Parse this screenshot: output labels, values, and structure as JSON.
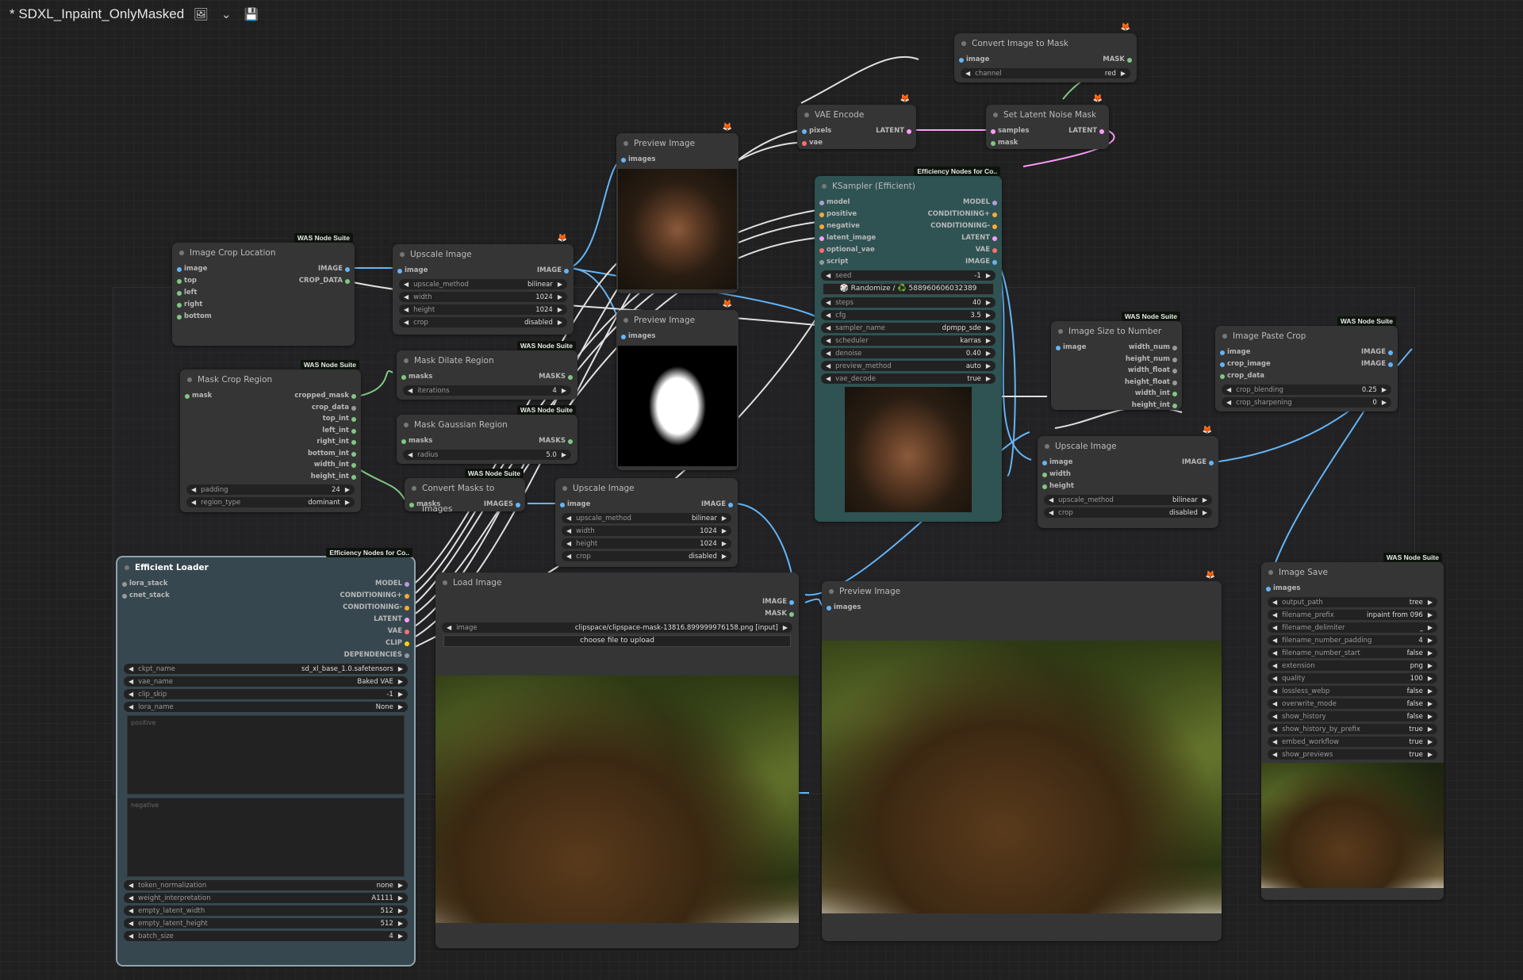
{
  "topbar": {
    "title": "* SDXL_Inpaint_OnlyMasked"
  },
  "colors": {
    "image": "#64b5f6",
    "mask": "#81c784",
    "latent": "#ff9cf9",
    "model": "#b39ddb",
    "cond": "#ffa931",
    "vae": "#ff6e6e",
    "clip": "#ffd500",
    "other": "#999999"
  },
  "nodes": {
    "convert_mask": {
      "title": "Convert Image to Mask",
      "in_image": "image",
      "out_mask": "MASK",
      "w_channel": "channel",
      "v_channel": "red"
    },
    "vae_encode": {
      "title": "VAE Encode",
      "in_pixels": "pixels",
      "in_vae": "vae",
      "out_latent": "LATENT"
    },
    "set_noise": {
      "title": "Set Latent Noise Mask",
      "in_samples": "samples",
      "in_mask": "mask",
      "out_latent": "LATENT"
    },
    "preview1": {
      "title": "Preview Image",
      "in_images": "images"
    },
    "preview2": {
      "title": "Preview Image",
      "in_images": "images"
    },
    "ksampler": {
      "badge": "Efficiency Nodes for Co..",
      "title": "KSampler (Efficient)",
      "inputs": [
        "model",
        "positive",
        "negative",
        "latent_image",
        "optional_vae",
        "script"
      ],
      "outputs": [
        "MODEL",
        "CONDITIONING+",
        "CONDITIONING-",
        "LATENT",
        "VAE",
        "IMAGE"
      ],
      "w_seed": "seed",
      "v_seed": "-1",
      "btn": "🎲 Randomize / ♻️ 588960606032389",
      "widgets": [
        {
          "l": "steps",
          "v": "40"
        },
        {
          "l": "cfg",
          "v": "3.5"
        },
        {
          "l": "sampler_name",
          "v": "dpmpp_sde"
        },
        {
          "l": "scheduler",
          "v": "karras"
        },
        {
          "l": "denoise",
          "v": "0.40"
        },
        {
          "l": "preview_method",
          "v": "auto"
        },
        {
          "l": "vae_decode",
          "v": "true"
        }
      ]
    },
    "crop_loc": {
      "badge": "WAS Node Suite",
      "title": "Image Crop Location",
      "inputs": [
        "image",
        "top",
        "left",
        "right",
        "bottom"
      ],
      "out_image": "IMAGE",
      "out_crop": "CROP_DATA"
    },
    "upscale1": {
      "title": "Upscale Image",
      "in_image": "image",
      "out_image": "IMAGE",
      "widgets": [
        {
          "l": "upscale_method",
          "v": "bilinear"
        },
        {
          "l": "width",
          "v": "1024"
        },
        {
          "l": "height",
          "v": "1024"
        },
        {
          "l": "crop",
          "v": "disabled"
        }
      ]
    },
    "mask_crop": {
      "badge": "WAS Node Suite",
      "title": "Mask Crop Region",
      "in_mask": "mask",
      "outputs": [
        "cropped_mask",
        "crop_data",
        "top_int",
        "left_int",
        "right_int",
        "bottom_int",
        "width_int",
        "height_int"
      ],
      "widgets": [
        {
          "l": "padding",
          "v": "24"
        },
        {
          "l": "region_type",
          "v": "dominant"
        }
      ]
    },
    "mask_dilate": {
      "badge": "WAS Node Suite",
      "title": "Mask Dilate Region",
      "in_masks": "masks",
      "out_masks": "MASKS",
      "w_l": "iterations",
      "w_v": "4"
    },
    "mask_gauss": {
      "badge": "WAS Node Suite",
      "title": "Mask Gaussian Region",
      "in_masks": "masks",
      "out_masks": "MASKS",
      "w_l": "radius",
      "w_v": "5.0"
    },
    "conv_masks": {
      "badge": "WAS Node Suite",
      "title": "Convert Masks to Images",
      "in_masks": "masks",
      "out_images": "IMAGES"
    },
    "upscale2": {
      "title": "Upscale Image",
      "in_image": "image",
      "out_image": "IMAGE",
      "widgets": [
        {
          "l": "upscale_method",
          "v": "bilinear"
        },
        {
          "l": "width",
          "v": "1024"
        },
        {
          "l": "height",
          "v": "1024"
        },
        {
          "l": "crop",
          "v": "disabled"
        }
      ]
    },
    "size_num": {
      "badge": "WAS Node Suite",
      "title": "Image Size to Number",
      "in_image": "image",
      "outputs": [
        "width_num",
        "height_num",
        "width_float",
        "height_float",
        "width_int",
        "height_int"
      ]
    },
    "paste_crop": {
      "badge": "WAS Node Suite",
      "title": "Image Paste Crop",
      "inputs": [
        "image",
        "crop_image",
        "crop_data"
      ],
      "outputs": [
        "IMAGE",
        "IMAGE"
      ],
      "widgets": [
        {
          "l": "crop_blending",
          "v": "0.25"
        },
        {
          "l": "crop_sharpening",
          "v": "0"
        }
      ]
    },
    "upscale3": {
      "title": "Upscale Image",
      "inputs": [
        "image",
        "width",
        "height"
      ],
      "out_image": "IMAGE",
      "widgets": [
        {
          "l": "upscale_method",
          "v": "bilinear"
        },
        {
          "l": "crop",
          "v": "disabled"
        }
      ]
    },
    "loader": {
      "badge": "Efficiency Nodes for Co..",
      "title": "Efficient Loader",
      "inputs": [
        "lora_stack",
        "cnet_stack"
      ],
      "outputs": [
        "MODEL",
        "CONDITIONING+",
        "CONDITIONING-",
        "LATENT",
        "VAE",
        "CLIP",
        "DEPENDENCIES"
      ],
      "widgets": [
        {
          "l": "ckpt_name",
          "v": "sd_xl_base_1.0.safetensors"
        },
        {
          "l": "vae_name",
          "v": "Baked VAE"
        },
        {
          "l": "clip_skip",
          "v": "-1"
        },
        {
          "l": "lora_name",
          "v": "None"
        }
      ],
      "positive": "positive",
      "negative": "negative",
      "widgets2": [
        {
          "l": "token_normalization",
          "v": "none"
        },
        {
          "l": "weight_interpretation",
          "v": "A1111"
        },
        {
          "l": "empty_latent_width",
          "v": "512"
        },
        {
          "l": "empty_latent_height",
          "v": "512"
        },
        {
          "l": "batch_size",
          "v": "4"
        }
      ]
    },
    "load_image": {
      "title": "Load Image",
      "out_image": "IMAGE",
      "out_mask": "MASK",
      "w_l": "image",
      "w_v": "clipspace/clipspace-mask-13816.899999976158.png [input]",
      "btn": "choose file to upload"
    },
    "preview3": {
      "title": "Preview Image",
      "in_images": "images"
    },
    "image_save": {
      "badge": "WAS Node Suite",
      "title": "Image Save",
      "in_images": "images",
      "widgets": [
        {
          "l": "output_path",
          "v": "tree"
        },
        {
          "l": "filename_prefix",
          "v": "inpaint from 096"
        },
        {
          "l": "filename_delimiter",
          "v": "_"
        },
        {
          "l": "filename_number_padding",
          "v": "4"
        },
        {
          "l": "filename_number_start",
          "v": "false"
        },
        {
          "l": "extension",
          "v": "png"
        },
        {
          "l": "quality",
          "v": "100"
        },
        {
          "l": "lossless_webp",
          "v": "false"
        },
        {
          "l": "overwrite_mode",
          "v": "false"
        },
        {
          "l": "show_history",
          "v": "false"
        },
        {
          "l": "show_history_by_prefix",
          "v": "true"
        },
        {
          "l": "embed_workflow",
          "v": "true"
        },
        {
          "l": "show_previews",
          "v": "true"
        }
      ]
    }
  }
}
